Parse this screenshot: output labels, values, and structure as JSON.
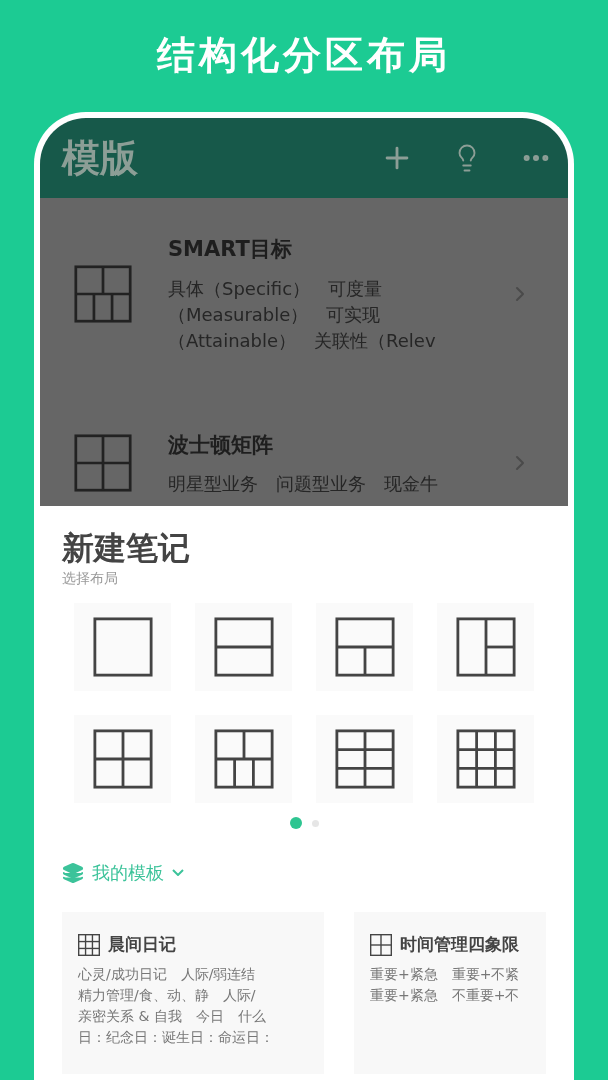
{
  "headline": "结构化分区布局",
  "app_bar": {
    "title": "模版"
  },
  "templates": [
    {
      "title": "SMART目标",
      "description": "具体（Specific）　可度量（Measurable）　可实现（Attainable）　关联性（Relev",
      "kind": "two-top-three-bottom"
    },
    {
      "title": "波士顿矩阵",
      "description": "明星型业务　问题型业务　现金牛",
      "kind": "quad"
    }
  ],
  "sheet": {
    "title": "新建笔记",
    "subtitle": "选择布局",
    "layouts": [
      {
        "kind": "single"
      },
      {
        "kind": "two-rows"
      },
      {
        "kind": "top-two-bottom"
      },
      {
        "kind": "left-right-split"
      },
      {
        "kind": "quad"
      },
      {
        "kind": "two-top-three-bottom"
      },
      {
        "kind": "two-by-three"
      },
      {
        "kind": "three-by-three"
      }
    ],
    "pages": [
      {
        "selected": true
      },
      {
        "selected": false
      }
    ],
    "my_templates": {
      "label": "我的模板",
      "expanded": false,
      "cards": [
        {
          "title": "晨间日记",
          "kind": "three-by-three",
          "lines": [
            "心灵/成功日记　人际/弱连结",
            "精力管理/食、动、静　人际/",
            "亲密关系 & 自我　今日　什么",
            "日：纪念日：诞生日：命运日："
          ]
        },
        {
          "title": "时间管理四象限",
          "kind": "quad",
          "lines": [
            "重要+紧急　重要+不紧",
            "重要+紧急　不重要+不"
          ]
        }
      ]
    }
  }
}
